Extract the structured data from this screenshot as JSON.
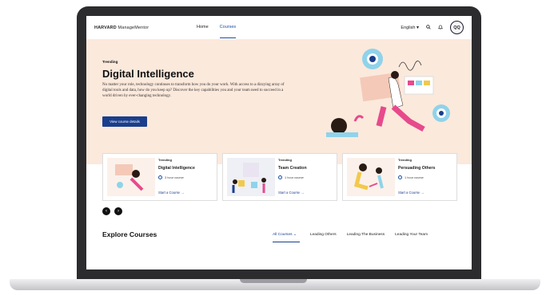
{
  "header": {
    "logo_bold": "HARVARD",
    "logo_rest": " ManageMentor",
    "nav": [
      "Home",
      "Courses"
    ],
    "language": "English",
    "avatar_initials": "QQ"
  },
  "hero": {
    "eyebrow": "Trending",
    "title": "Digital Intelligence",
    "description": "No matter your role, technology continues to transform how you do your work. With access to a dizzying array of digital tools and data, how do you keep up? Discover the key capabilities you and your team need to succeed in a world driven by ever-changing technology.",
    "cta": "View course details",
    "colors": {
      "background": "#fbe9dc",
      "button": "#1a3e8c"
    }
  },
  "cards": [
    {
      "tag": "Trending",
      "title": "Digital Intelligence",
      "duration": "3 hour course",
      "cta": "Start a Course →"
    },
    {
      "tag": "Trending",
      "title": "Team Creation",
      "duration": "1 hour course",
      "cta": "Start a Course →"
    },
    {
      "tag": "Trending",
      "title": "Persuading Others",
      "duration": "1 hour course",
      "cta": "Start a Course →"
    }
  ],
  "pager": {
    "prev": "‹",
    "next": "›"
  },
  "explore": {
    "title": "Explore Courses",
    "tabs": [
      "All Courses",
      "Leading Others",
      "Leading The Business",
      "Leading Your Team"
    ]
  }
}
